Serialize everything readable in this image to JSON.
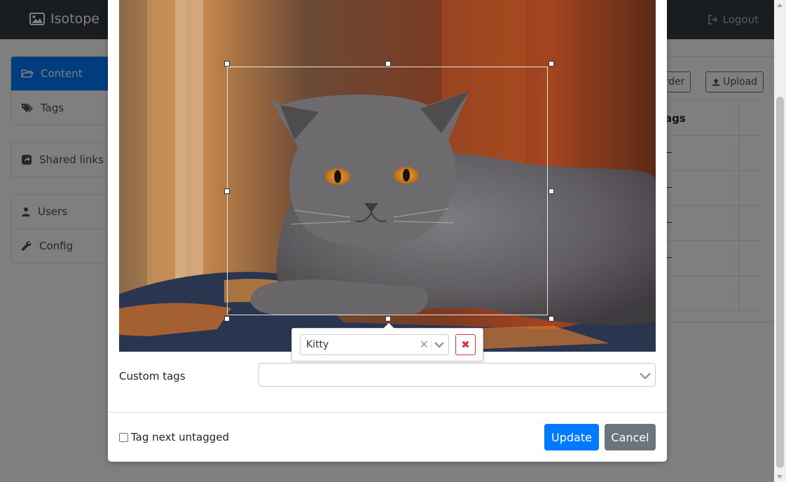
{
  "navbar": {
    "brand": "Isotope",
    "logout": "Logout"
  },
  "sidebar": {
    "groups": [
      [
        {
          "label": "Content",
          "icon": "folder-open-icon",
          "active": true
        },
        {
          "label": "Tags",
          "icon": "tags-icon",
          "active": false
        }
      ],
      [
        {
          "label": "Shared links",
          "icon": "share-square-icon",
          "active": false
        }
      ],
      [
        {
          "label": "Users",
          "icon": "user-icon",
          "active": false
        },
        {
          "label": "Config",
          "icon": "wrench-icon",
          "active": false
        }
      ]
    ]
  },
  "main": {
    "reorder_label": "order",
    "upload_label": "Upload",
    "table_header": "ags",
    "row_values": [
      "–",
      "–",
      "–",
      "–",
      ""
    ]
  },
  "modal": {
    "crop_tag": {
      "value": "Kitty"
    },
    "custom_tags": {
      "label": "Custom tags",
      "value": ""
    },
    "tag_next_untagged": {
      "label": "Tag next untagged",
      "checked": false
    },
    "update_label": "Update",
    "cancel_label": "Cancel"
  },
  "colors": {
    "primary": "#007bff",
    "secondary": "#6c757d",
    "danger": "#dc3545",
    "navbar": "#343a40"
  }
}
